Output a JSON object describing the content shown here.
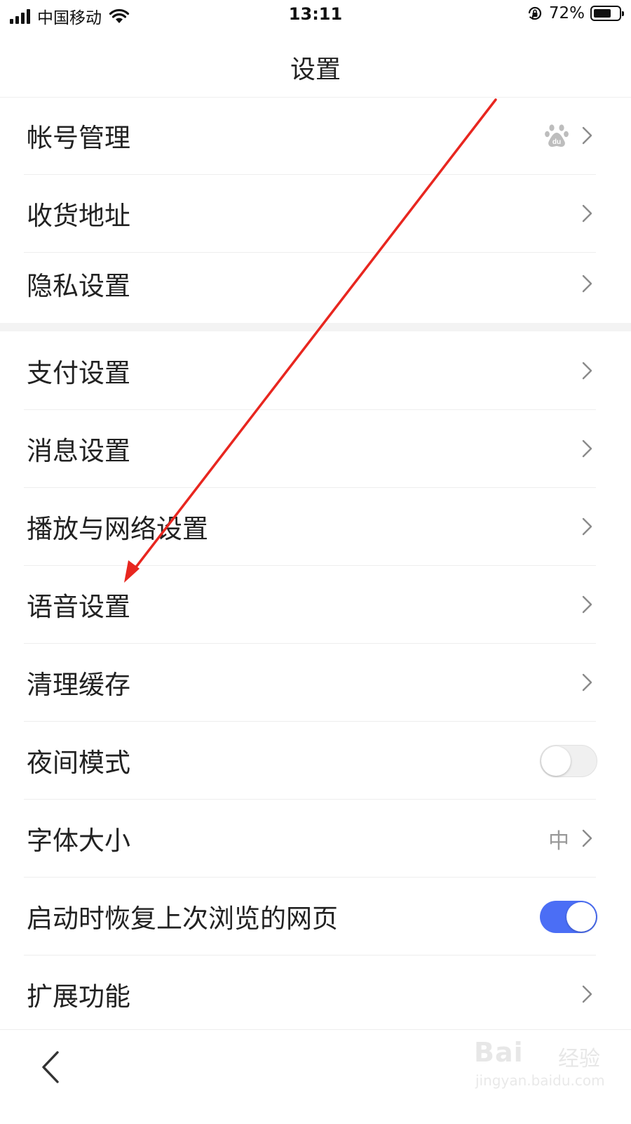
{
  "status_bar": {
    "carrier": "中国移动",
    "time": "13:11",
    "battery_percent_text": "72%",
    "battery_level": 0.72,
    "signal_icon": "signal-bars-icon",
    "wifi_icon": "wifi-icon",
    "rotation_lock_icon": "rotation-lock-icon"
  },
  "nav": {
    "title": "设置"
  },
  "settings": {
    "account": {
      "label": "帐号管理",
      "badge_icon": "baidu-paw-icon"
    },
    "address": {
      "label": "收货地址"
    },
    "privacy": {
      "label": "隐私设置"
    },
    "payment": {
      "label": "支付设置"
    },
    "message": {
      "label": "消息设置"
    },
    "playback": {
      "label": "播放与网络设置"
    },
    "voice": {
      "label": "语音设置"
    },
    "cache": {
      "label": "清理缓存"
    },
    "night_mode": {
      "label": "夜间模式",
      "enabled": false
    },
    "font_size": {
      "label": "字体大小",
      "value": "中"
    },
    "restore": {
      "label": "启动时恢复上次浏览的网页",
      "enabled": true
    },
    "extensions": {
      "label": "扩展功能"
    }
  },
  "bottom": {
    "back_icon": "chevron-left-icon"
  },
  "watermark": {
    "brand": "Bai",
    "brand2": "经验",
    "url": "jingyan.baidu.com"
  },
  "colors": {
    "accent": "#4b6ef5",
    "annotation_arrow": "#e8261f",
    "chevron": "#8a8a8a",
    "divider": "#eeeeee"
  }
}
